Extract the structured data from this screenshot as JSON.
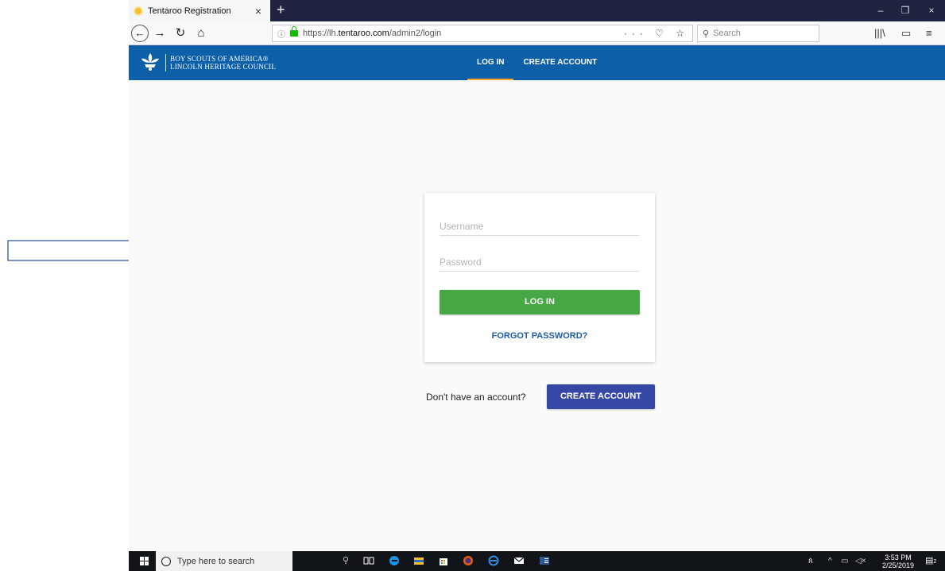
{
  "browser": {
    "tab_title": "Tentaroo Registration",
    "tab_close": "×",
    "new_tab": "+",
    "window_controls": {
      "minimize": "–",
      "restore": "❐",
      "close": "×"
    },
    "nav": {
      "back": "←",
      "forward": "→",
      "reload": "↻",
      "home": "⌂"
    },
    "url_info": "ⓘ",
    "url_prefix": "https://lh.",
    "url_host": "tentaroo.com",
    "url_path": "/admin2/login",
    "url_actions": "··· ♡ ☆",
    "search_placeholder": "Search",
    "tools": {
      "library": "|||\\",
      "sidebar": "▭",
      "menu": "≡"
    }
  },
  "site": {
    "org_line1": "BOY SCOUTS OF AMERICA®",
    "org_line2": "LINCOLN HERITAGE COUNCIL",
    "nav_login": "LOG IN",
    "nav_create": "CREATE ACCOUNT"
  },
  "login": {
    "username_placeholder": "Username",
    "password_placeholder": "Password",
    "login_button": "LOG IN",
    "forgot_password": "FORGOT PASSWORD?",
    "no_account_text": "Don't have an account?",
    "create_account_button": "CREATE ACCOUNT"
  },
  "taskbar": {
    "search_placeholder": "Type here to search",
    "time": "3:53 PM",
    "date": "2/25/2019",
    "notification_count": "2"
  },
  "colors": {
    "header": "#0d5fa8",
    "login_button": "#47a745",
    "create_button": "#3747a6",
    "link": "#1c5ea6",
    "active_underline": "#f6a623"
  }
}
